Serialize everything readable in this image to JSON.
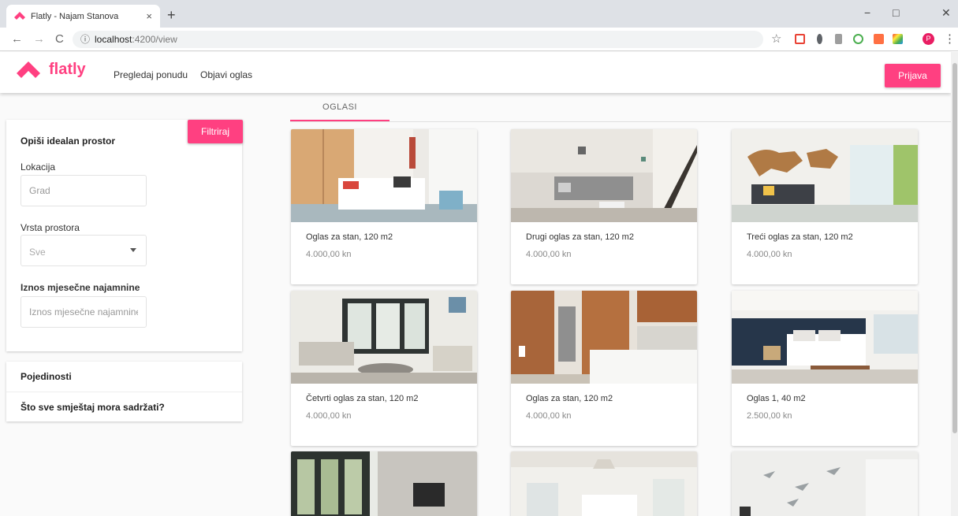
{
  "browser": {
    "tab_title": "Flatly - Najam Stanova",
    "tab_close": "×",
    "new_tab": "+",
    "url_host": "localhost",
    "url_path": ":4200/view",
    "back": "←",
    "forward": "→",
    "reload": "C",
    "info": "ⓘ",
    "bookmark": "☆",
    "menu": "⋮",
    "minimize": "−",
    "maximize": "□",
    "close": "✕",
    "profile_initial": "P"
  },
  "header": {
    "brand": "flatly",
    "nav": [
      "Pregledaj ponudu",
      "Objavi oglas"
    ],
    "login_label": "Prijava",
    "accent_color": "#ff4081"
  },
  "tabs": [
    {
      "label": "OGLASI",
      "active": true
    }
  ],
  "filter": {
    "button_label": "Filtriraj",
    "title": "Opiši idealan prostor",
    "location_label": "Lokacija",
    "location_placeholder": "Grad",
    "type_label": "Vrsta prostora",
    "type_value": "Sve",
    "rent_label": "Iznos mjesečne najamnine",
    "rent_placeholder": "Iznos mjesečne najamnine"
  },
  "accordion": [
    "Pojedinosti",
    "Što sve smještaj mora sadržati?"
  ],
  "listings": [
    {
      "title": "Oglas za stan, 120 m2",
      "price": "4.000,00 kn",
      "image": "bedroom-photo"
    },
    {
      "title": "Drugi oglas za stan, 120 m2",
      "price": "4.000,00 kn",
      "image": "living-room-photo"
    },
    {
      "title": "Treći oglas za stan, 120 m2",
      "price": "4.000,00 kn",
      "image": "living-room-map-photo"
    },
    {
      "title": "Četvrti oglas za stan, 120 m2",
      "price": "4.000,00 kn",
      "image": "sunroom-photo"
    },
    {
      "title": "Oglas za stan, 120 m2",
      "price": "4.000,00 kn",
      "image": "kitchen-photo"
    },
    {
      "title": "Oglas 1, 40 m2",
      "price": "2.500,00 kn",
      "image": "navy-bedroom-photo"
    },
    {
      "title": "",
      "price": "",
      "image": "stone-fireplace-photo"
    },
    {
      "title": "",
      "price": "",
      "image": "white-kitchen-photo"
    },
    {
      "title": "",
      "price": "",
      "image": "birds-interior-photo"
    }
  ]
}
